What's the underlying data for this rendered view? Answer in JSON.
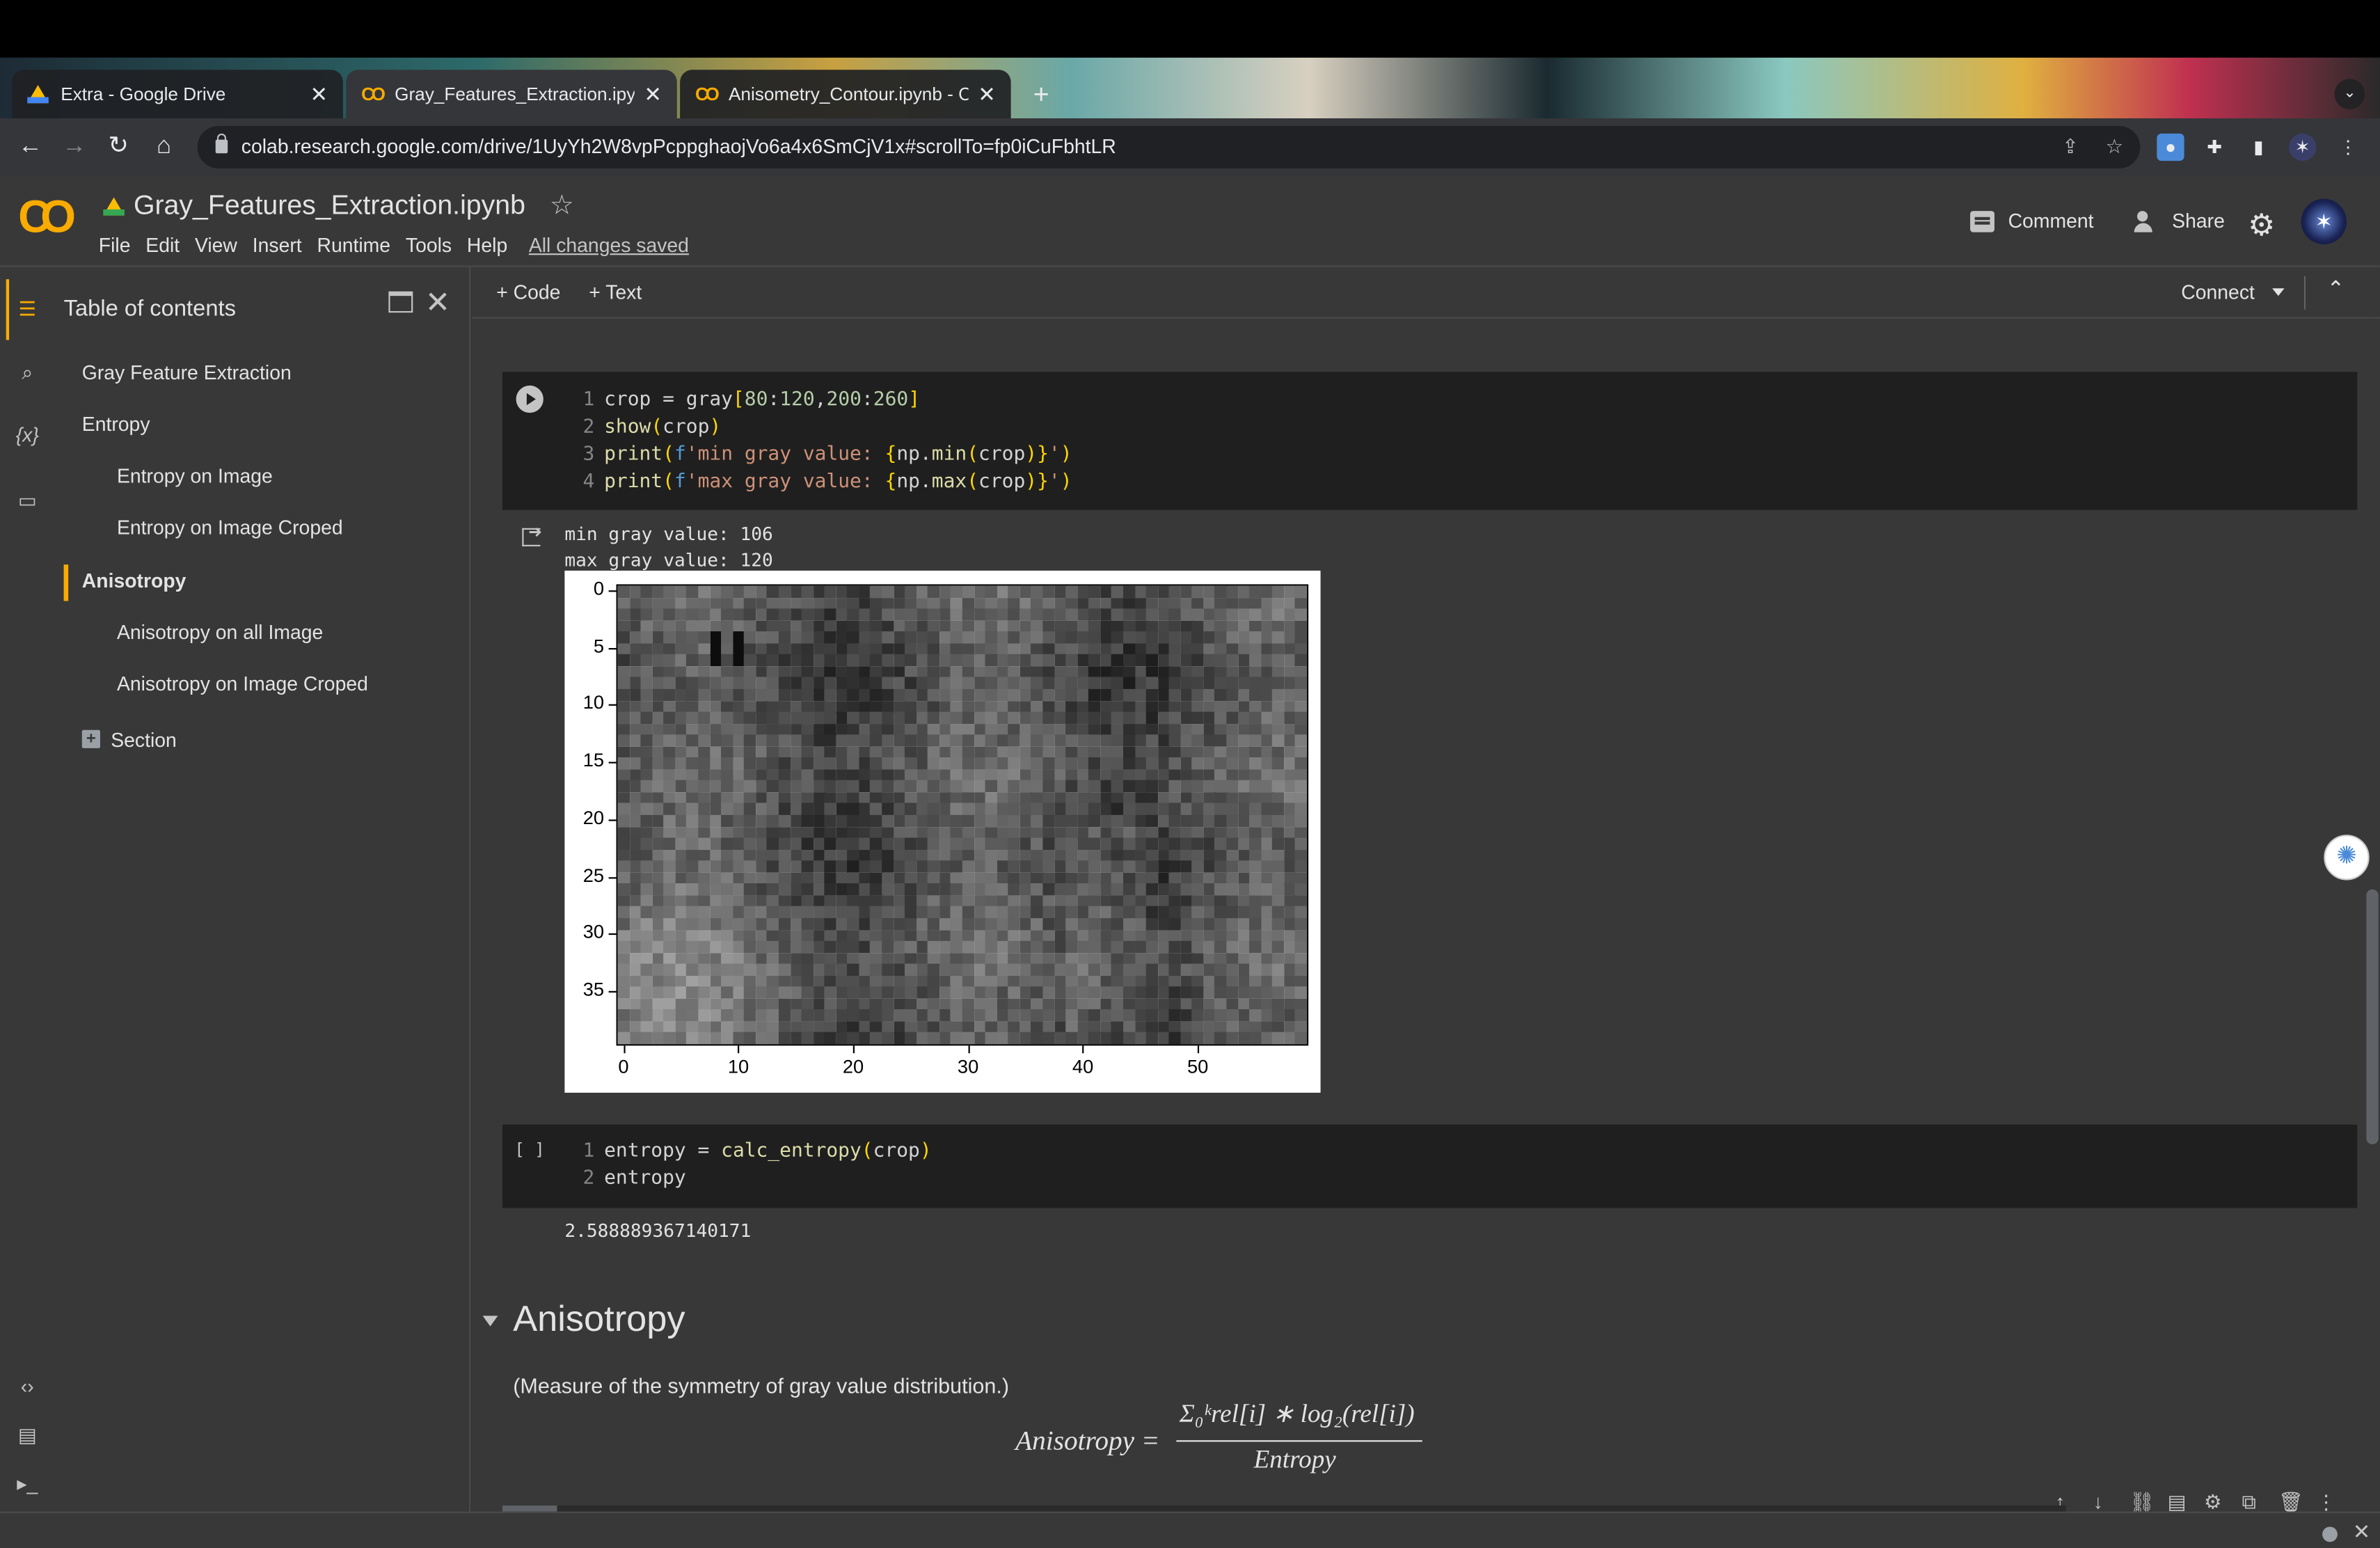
{
  "browser": {
    "tabs": [
      {
        "title": "Extra - Google Drive",
        "favicon": "google-drive-icon"
      },
      {
        "title": "Gray_Features_Extraction.ipyn",
        "favicon": "colab-icon"
      },
      {
        "title": "Anisometry_Contour.ipynb - C",
        "favicon": "colab-icon"
      }
    ],
    "close_glyph": "✕",
    "new_tab_glyph": "+",
    "url": "colab.research.google.com/drive/1UyYh2W8vpPcppghaojVo6a4x6SmCjV1x#scrollTo=fp0iCuFbhtLR"
  },
  "colab": {
    "logo": "CO",
    "notebook_title": "Gray_Features_Extraction.ipynb",
    "menu": [
      "File",
      "Edit",
      "View",
      "Insert",
      "Runtime",
      "Tools",
      "Help"
    ],
    "save_status": "All changes saved",
    "comment_label": "Comment",
    "share_label": "Share"
  },
  "toc": {
    "title": "Table of contents",
    "items": [
      {
        "label": "Gray Feature Extraction",
        "level": 1
      },
      {
        "label": "Entropy",
        "level": 1
      },
      {
        "label": "Entropy on Image",
        "level": 2
      },
      {
        "label": "Entropy on Image Croped",
        "level": 2
      },
      {
        "label": "Anisotropy",
        "level": 1,
        "selected": true
      },
      {
        "label": "Anisotropy on all Image",
        "level": 2
      },
      {
        "label": "Anisotropy on Image Croped",
        "level": 2
      }
    ],
    "section_label": "Section"
  },
  "notebook_toolbar": {
    "code_label": "+ Code",
    "text_label": "+ Text",
    "connect_label": "Connect"
  },
  "cells": {
    "cell1_lines": [
      "crop = gray[80:120,200:260]",
      "show(crop)",
      "print(f'min gray value: {np.min(crop)}')",
      "print(f'max gray value: {np.max(crop)}')"
    ],
    "cell1_output": [
      "min gray value: 106",
      "max gray value: 120"
    ],
    "cell2_exec": "[ ]",
    "cell2_lines": [
      "entropy = calc_entropy(crop)",
      "entropy"
    ],
    "cell2_output": "2.588889367140171"
  },
  "markdown": {
    "heading": "Anisotropy",
    "text": "(Measure of the symmetry of gray value distribution.)",
    "formula_lhs": "Anisotropy =",
    "formula_numerator": "Σ₀ᵏrel[i] ∗ log₂(rel[i])",
    "formula_denominator": "Entropy"
  },
  "chart_data": {
    "type": "heatmap",
    "colormap": "gray",
    "grid_size": [
      40,
      60
    ],
    "x_ticks": [
      "0",
      "10",
      "20",
      "30",
      "40",
      "50"
    ],
    "y_ticks": [
      "0",
      "5",
      "10",
      "15",
      "20",
      "25",
      "30",
      "35"
    ],
    "value_range": [
      106,
      120
    ]
  }
}
